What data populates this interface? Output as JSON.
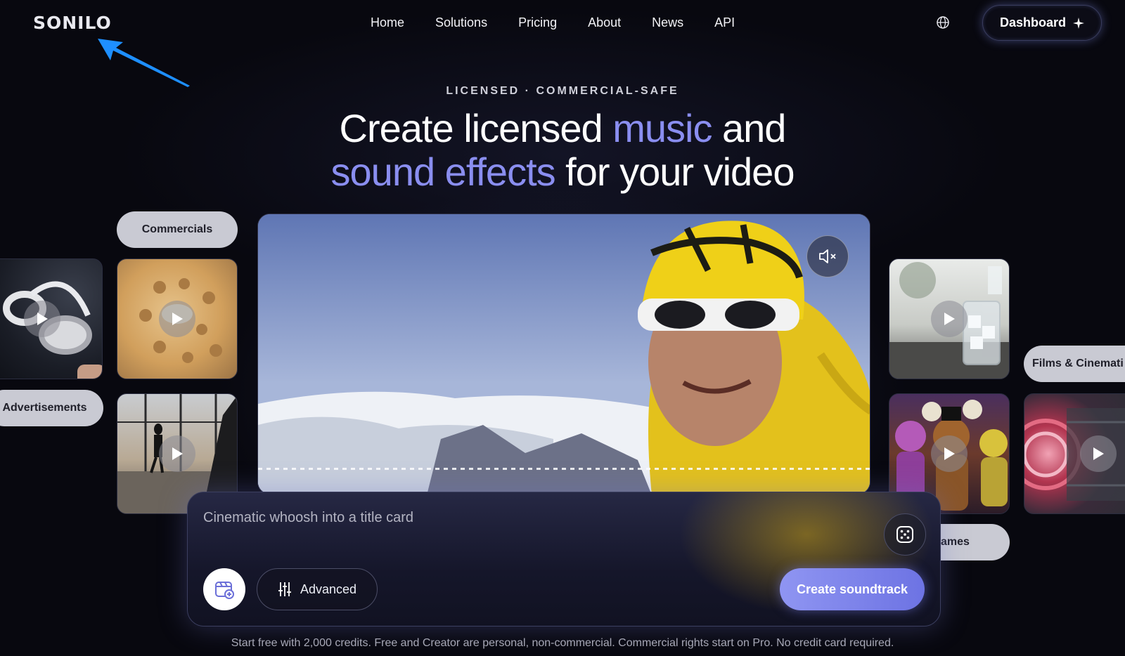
{
  "nav": {
    "logo": "SONILO",
    "links": [
      "Home",
      "Solutions",
      "Pricing",
      "About",
      "News",
      "API"
    ],
    "language_icon": "globe-icon",
    "dashboard_label": "Dashboard",
    "dashboard_icon": "sparkle-icon"
  },
  "hero": {
    "eyebrow": "LICENSED · COMMERCIAL-SAFE",
    "line1_a": "Create licensed ",
    "line1_accent": "music",
    "line1_b": " and",
    "line2_accent": "sound effects",
    "line2_b": " for your video",
    "accent_color": "#8a8ef0"
  },
  "categories": {
    "commercials": "Commercials",
    "advertisements": "Advertisements",
    "films": "Films & Cinemati",
    "games": "ames"
  },
  "thumbnails": [
    {
      "name": "headphones",
      "icon": "play-icon"
    },
    {
      "name": "waffle",
      "icon": "play-icon"
    },
    {
      "name": "airport-silhouette",
      "icon": "play-icon"
    },
    {
      "name": "ice-glass",
      "icon": "play-icon"
    },
    {
      "name": "animatronics",
      "icon": "play-icon"
    },
    {
      "name": "turbine",
      "icon": "play-icon"
    }
  ],
  "video": {
    "mute_icon": "speaker-muted-icon"
  },
  "prompt": {
    "placeholder": "Cinematic whoosh into a title card",
    "dice_icon": "dice-icon",
    "upload_icon": "video-upload-icon",
    "advanced_label": "Advanced",
    "advanced_icon": "sliders-icon",
    "create_label": "Create soundtrack"
  },
  "footnote": "Start free with 2,000 credits. Free and Creator are personal, non-commercial. Commercial rights start on Pro. No credit card required."
}
